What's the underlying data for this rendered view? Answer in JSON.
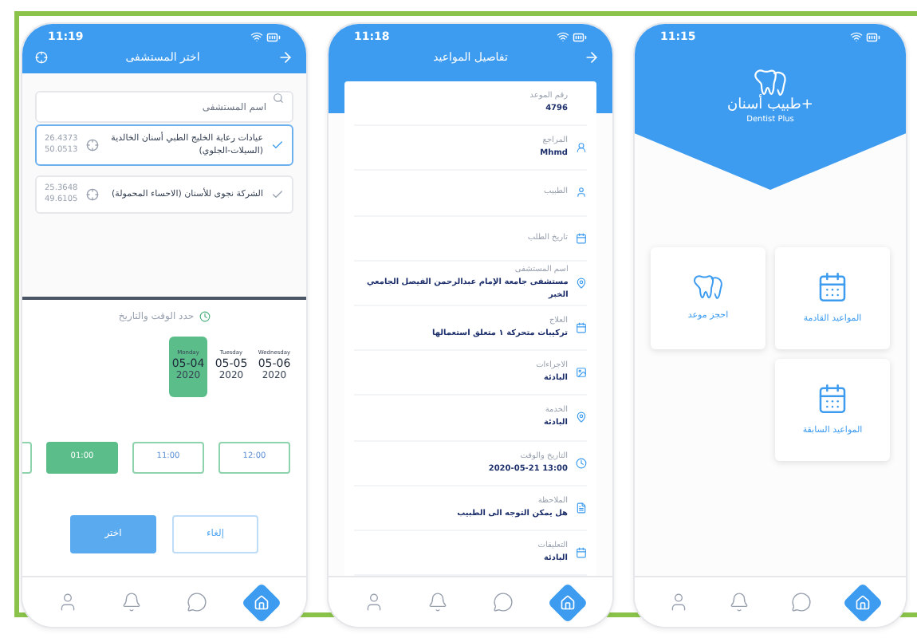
{
  "phones": [
    {
      "kind": "home",
      "time": "11:15",
      "brand": "طبيب أسنان+",
      "subtitle": "Dentist Plus",
      "cards": [
        {
          "label": "المواعيد القادمة"
        },
        {
          "label": "احجز موعد"
        },
        {
          "label": "المواعيد السابقة"
        }
      ],
      "nav": [
        {
          "selected": false
        },
        {
          "selected": false
        },
        {
          "selected": false
        },
        {
          "selected": true
        }
      ]
    },
    {
      "kind": "details",
      "time": "11:18",
      "title": "تفاصيل المواعيد",
      "fields": [
        {
          "label": "رقم الموعد",
          "value": "4796"
        },
        {
          "label": "المراجع",
          "value": "Mhmd"
        },
        {
          "label": "الطبيب"
        },
        {
          "label": "تاريخ الطلب"
        },
        {
          "label": "اسم المستشفى",
          "value": "مستشفى جامعة الإمام عبدالرحمن الفيصل الجامعي الخبر"
        },
        {
          "label": "العلاج",
          "value": "تركيبات متحركة ١ متعلق استعمالها"
        },
        {
          "label": "الاجراءات",
          "value": "البادئة"
        },
        {
          "label": "الخدمة",
          "value": "البادئة"
        },
        {
          "label": "التاريخ والوقت",
          "value": "13:00 2020-05-21"
        },
        {
          "label": "الملاحظة",
          "value": "هل يمكن التوجه الى الطبيب"
        },
        {
          "label": "التعليقات",
          "value": "البادئة"
        }
      ],
      "nav": [
        {
          "selected": false
        },
        {
          "selected": false
        },
        {
          "selected": false
        },
        {
          "selected": true
        }
      ]
    },
    {
      "kind": "hospital_picker",
      "time": "11:19",
      "title": "اختر المستشفى",
      "search": {
        "placeholder": "اسم المستشفى"
      },
      "hospitals": [
        {
          "name": "عيادات رعاية الخليج الطبي أسنان الخالدية (السيلات-الجلوي)",
          "lat": "26.4373",
          "lng": "50.0513",
          "selected": true
        },
        {
          "name": "الشركة نجوى للأسنان (الاحساء المحمولة)",
          "lat": "25.3648",
          "lng": "49.6105",
          "selected": false
        }
      ],
      "sheet": {
        "title": "حدد الوقت والتاريخ",
        "days": [
          {
            "weekday": "Wednesday",
            "date": "05-06",
            "year": "2020",
            "selected": false
          },
          {
            "weekday": "Tuesday",
            "date": "05-05",
            "year": "2020",
            "selected": false
          },
          {
            "weekday": "Monday",
            "date": "05-04",
            "year": "2020",
            "selected": true
          }
        ],
        "times": [
          {
            "label": "12:00",
            "selected": false
          },
          {
            "label": "11:00",
            "selected": false
          },
          {
            "label": "01:00",
            "selected": true
          }
        ],
        "buttons": [
          {
            "label": "إلغاء",
            "kind": "secondary"
          },
          {
            "label": "اختر",
            "kind": "primary"
          }
        ]
      },
      "nav": [
        {
          "selected": false
        },
        {
          "selected": false
        },
        {
          "selected": false
        },
        {
          "selected": true
        }
      ]
    }
  ]
}
